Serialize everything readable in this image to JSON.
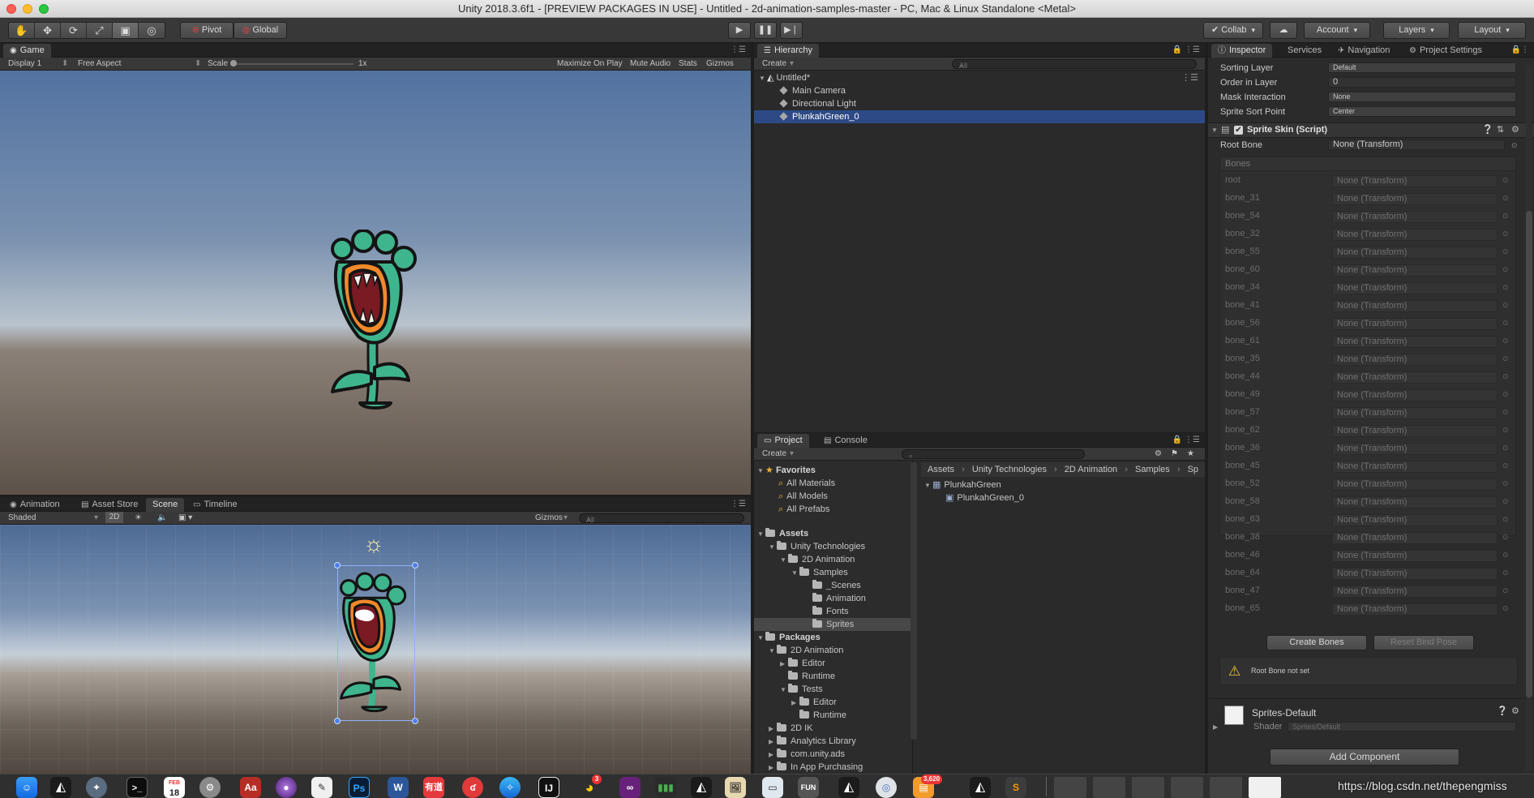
{
  "window": {
    "title": "Unity 2018.3.6f1 - [PREVIEW PACKAGES IN USE] - Untitled - 2d-animation-samples-master - PC, Mac & Linux Standalone <Metal>"
  },
  "toolbar": {
    "tools": [
      "hand-icon",
      "move-icon",
      "rotate-icon",
      "scale-icon",
      "rect-icon",
      "transform-icon"
    ],
    "pivot": "Pivot",
    "global": "Global",
    "collab": "Collab",
    "account": "Account",
    "layers": "Layers",
    "layout": "Layout"
  },
  "game": {
    "tab": "Game",
    "display": "Display 1",
    "aspect": "Free Aspect",
    "scale_label": "Scale",
    "scale_value": "1x",
    "maximize": "Maximize On Play",
    "mute": "Mute Audio",
    "stats": "Stats",
    "gizmos": "Gizmos"
  },
  "scene_tabs": {
    "animation": "Animation",
    "asset_store": "Asset Store",
    "scene": "Scene",
    "timeline": "Timeline"
  },
  "scene": {
    "shading": "Shaded",
    "mode2d": "2D",
    "gizmos": "Gizmos",
    "search_placeholder": "All"
  },
  "hierarchy": {
    "tab": "Hierarchy",
    "create": "Create",
    "search_placeholder": "All",
    "root": "Untitled*",
    "items": [
      "Main Camera",
      "Directional Light",
      "PlunkahGreen_0"
    ]
  },
  "project": {
    "tab_project": "Project",
    "tab_console": "Console",
    "create": "Create",
    "favorites": {
      "label": "Favorites",
      "items": [
        "All Materials",
        "All Models",
        "All Prefabs"
      ]
    },
    "assets": {
      "label": "Assets",
      "unity_tech": "Unity Technologies",
      "anim2d": "2D Animation",
      "samples": "Samples",
      "sample_children": [
        "_Scenes",
        "Animation",
        "Fonts",
        "Sprites"
      ]
    },
    "packages": {
      "label": "Packages",
      "anim2d": "2D Animation",
      "editor": "Editor",
      "runtime": "Runtime",
      "tests": "Tests",
      "tests_editor": "Editor",
      "tests_runtime": "Runtime",
      "others": [
        "2D IK",
        "Analytics Library",
        "com.unity.ads",
        "In App Purchasing"
      ]
    },
    "breadcrumb": [
      "Assets",
      "Unity Technologies",
      "2D Animation",
      "Samples",
      "Sp"
    ],
    "files": {
      "parent": "PlunkahGreen",
      "child": "PlunkahGreen_0"
    }
  },
  "inspector": {
    "tabs": [
      "Inspector",
      "Services",
      "Navigation",
      "Project Settings"
    ],
    "sorting_layer": {
      "label": "Sorting Layer",
      "value": "Default"
    },
    "order_in_layer": {
      "label": "Order in Layer",
      "value": "0"
    },
    "mask_interaction": {
      "label": "Mask Interaction",
      "value": "None"
    },
    "sprite_sort_point": {
      "label": "Sprite Sort Point",
      "value": "Center"
    },
    "sprite_skin": {
      "title": "Sprite Skin (Script)",
      "root_bone_label": "Root Bone",
      "root_bone_value": "None (Transform)"
    },
    "bones_header": "Bones",
    "bones": [
      "root",
      "bone_31",
      "bone_54",
      "bone_32",
      "bone_55",
      "bone_60",
      "bone_34",
      "bone_41",
      "bone_56",
      "bone_61",
      "bone_35",
      "bone_44",
      "bone_49",
      "bone_57",
      "bone_62",
      "bone_36",
      "bone_45",
      "bone_52",
      "bone_58",
      "bone_63",
      "bone_38",
      "bone_46",
      "bone_64",
      "bone_47",
      "bone_65"
    ],
    "bone_value": "None (Transform)",
    "create_bones": "Create Bones",
    "reset_bind_pose": "Reset Bind Pose",
    "warning": "Root Bone not set",
    "material": {
      "name": "Sprites-Default",
      "shader_label": "Shader",
      "shader_value": "Sprites/Default"
    },
    "add_component": "Add Component"
  },
  "dock": {
    "watermark": "https://blog.csdn.net/thepengmiss",
    "calendar_month": "FEB",
    "calendar_day": "18",
    "word": "W",
    "ps": "Ps",
    "ij": "IJ",
    "youdao": "有道",
    "qq_badge": "3",
    "badge": "3,620"
  }
}
